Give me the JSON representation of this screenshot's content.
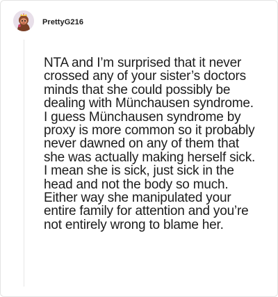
{
  "comment": {
    "username": "PrettyG216",
    "avatar_icon": "cartoon-character-avatar-icon",
    "text": "NTA and I’m surprised that it never crossed any of your sister’s doctors minds that she could possibly be dealing with Münchausen syndrome. I guess Münchausen syndrome by proxy is more common so it probably never dawned on any of them that she was actually making herself sick. I mean she is sick, just sick in the head and not the body so much. Either way she manipulated your entire family for attention and you’re not entirely wrong to blame her."
  },
  "colors": {
    "text": "#1c1c1c",
    "border": "#e4e4e4",
    "avatar_bg": "#e8dfe9"
  }
}
